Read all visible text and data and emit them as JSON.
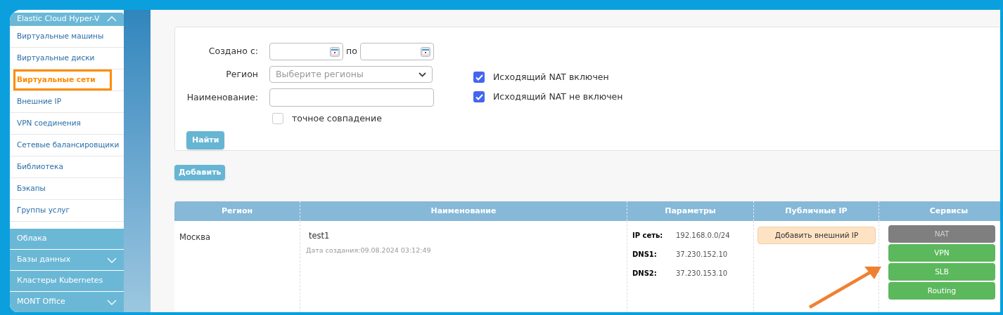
{
  "sidebar": {
    "group": {
      "title": "Elastic Cloud Hyper-V",
      "expanded": true
    },
    "items": [
      {
        "label": "Виртуальные машины",
        "selected": false
      },
      {
        "label": "Виртуальные диски",
        "selected": false
      },
      {
        "label": "Виртуальные сети",
        "selected": true
      },
      {
        "label": "Внешние IP",
        "selected": false
      },
      {
        "label": "VPN соединения",
        "selected": false
      },
      {
        "label": "Сетевые балансировщики",
        "selected": false
      },
      {
        "label": "Библиотека",
        "selected": false
      },
      {
        "label": "Бэкапы",
        "selected": false
      },
      {
        "label": "Группы услуг",
        "selected": false
      }
    ],
    "sections": [
      {
        "label": "Облака",
        "expandable": false
      },
      {
        "label": "Базы данных",
        "expandable": true
      },
      {
        "label": "Кластеры Kubernetes",
        "expandable": false
      },
      {
        "label": "MONT Office",
        "expandable": true
      }
    ]
  },
  "filter": {
    "created_from_label": "Создано с:",
    "to_label": "по",
    "region_label": "Регион",
    "region_placeholder": "Выберите регионы",
    "name_label": "Наименование:",
    "exact_match": {
      "label": "точное совпадение",
      "checked": false
    },
    "nat_options": [
      {
        "label": "Исходящий NAT включен",
        "checked": true
      },
      {
        "label": "Исходящий NAT не включен",
        "checked": true
      }
    ],
    "search_button": "Найти"
  },
  "add_button": "Добавить",
  "table": {
    "columns": [
      "Регион",
      "Наименование",
      "Параметры",
      "Публичные IP",
      "Сервисы"
    ],
    "rows": [
      {
        "region": "Москва",
        "name": "test1",
        "created": "Дата создания:09.08.2024 03:12:49",
        "params": [
          {
            "label": "IP сеть:",
            "value": "192.168.0.0/24"
          },
          {
            "label": "DNS1:",
            "value": "37.230.152.10"
          },
          {
            "label": "DNS2:",
            "value": "37.230.153.10"
          }
        ],
        "public_ip_button": "Добавить внешний IP",
        "services": [
          {
            "label": "NAT",
            "enabled": false
          },
          {
            "label": "VPN",
            "enabled": true
          },
          {
            "label": "SLB",
            "enabled": true
          },
          {
            "label": "Routing",
            "enabled": true
          }
        ]
      }
    ]
  }
}
